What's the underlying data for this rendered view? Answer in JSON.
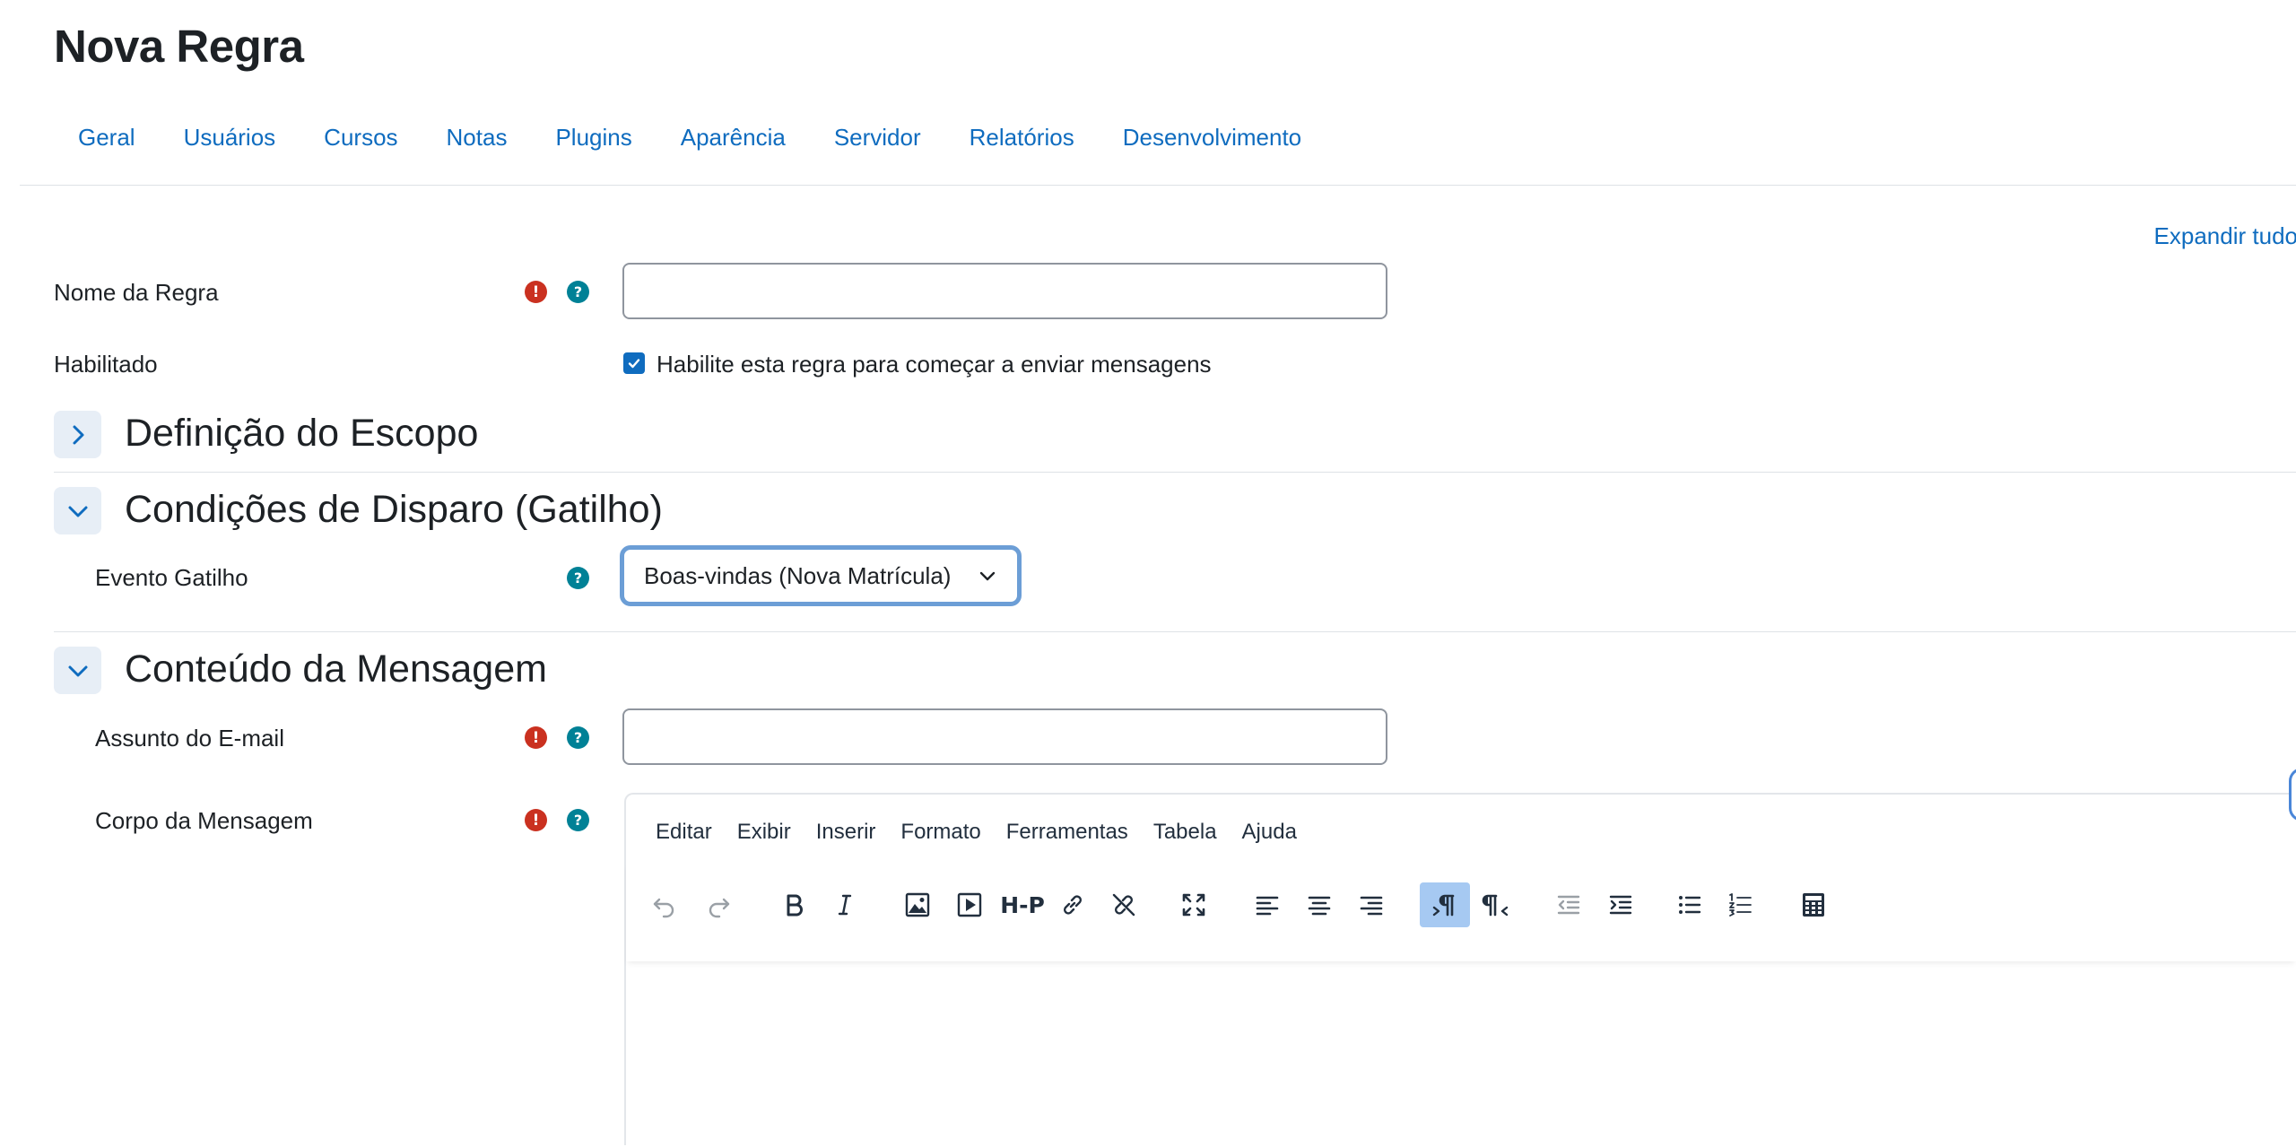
{
  "page": {
    "title": "Nova Regra"
  },
  "nav": {
    "tabs": [
      "Geral",
      "Usuários",
      "Cursos",
      "Notas",
      "Plugins",
      "Aparência",
      "Servidor",
      "Relatórios",
      "Desenvolvimento"
    ]
  },
  "form": {
    "expand_all": "Expandir tudo",
    "rule_name": {
      "label": "Nome da Regra",
      "value": ""
    },
    "enabled": {
      "label": "Habilitado",
      "checkbox_label": "Habilite esta regra para começar a enviar mensagens",
      "checked": true
    },
    "sections": {
      "scope": {
        "title": "Definição do Escopo",
        "expanded": false
      },
      "trigger": {
        "title": "Condições de Disparo (Gatilho)",
        "expanded": true,
        "event_label": "Evento Gatilho",
        "event_value": "Boas-vindas (Nova Matrícula)"
      },
      "message": {
        "title": "Conteúdo da Mensagem",
        "expanded": true,
        "subject_label": "Assunto do E-mail",
        "subject_value": "",
        "body_label": "Corpo da Mensagem"
      }
    }
  },
  "editor": {
    "menu": [
      "Editar",
      "Exibir",
      "Inserir",
      "Formato",
      "Ferramentas",
      "Tabela",
      "Ajuda"
    ],
    "toolbar_icons": [
      "undo-icon",
      "redo-icon",
      "bold-icon",
      "italic-icon",
      "image-icon",
      "media-icon",
      "h5p-icon",
      "link-icon",
      "unlink-icon",
      "fullscreen-icon",
      "align-left-icon",
      "align-center-icon",
      "align-right-icon",
      "ltr-icon",
      "rtl-icon",
      "outdent-icon",
      "indent-icon",
      "bullet-list-icon",
      "numbered-list-icon",
      "calculator-icon"
    ],
    "h5p_label": "H-P",
    "active_tool": "ltr-icon"
  },
  "colors": {
    "link": "#0f6cbf",
    "required": "#ca3120",
    "help": "#008196",
    "focus_ring": "#6c9ed6",
    "active_tool": "#a6c9f2"
  }
}
